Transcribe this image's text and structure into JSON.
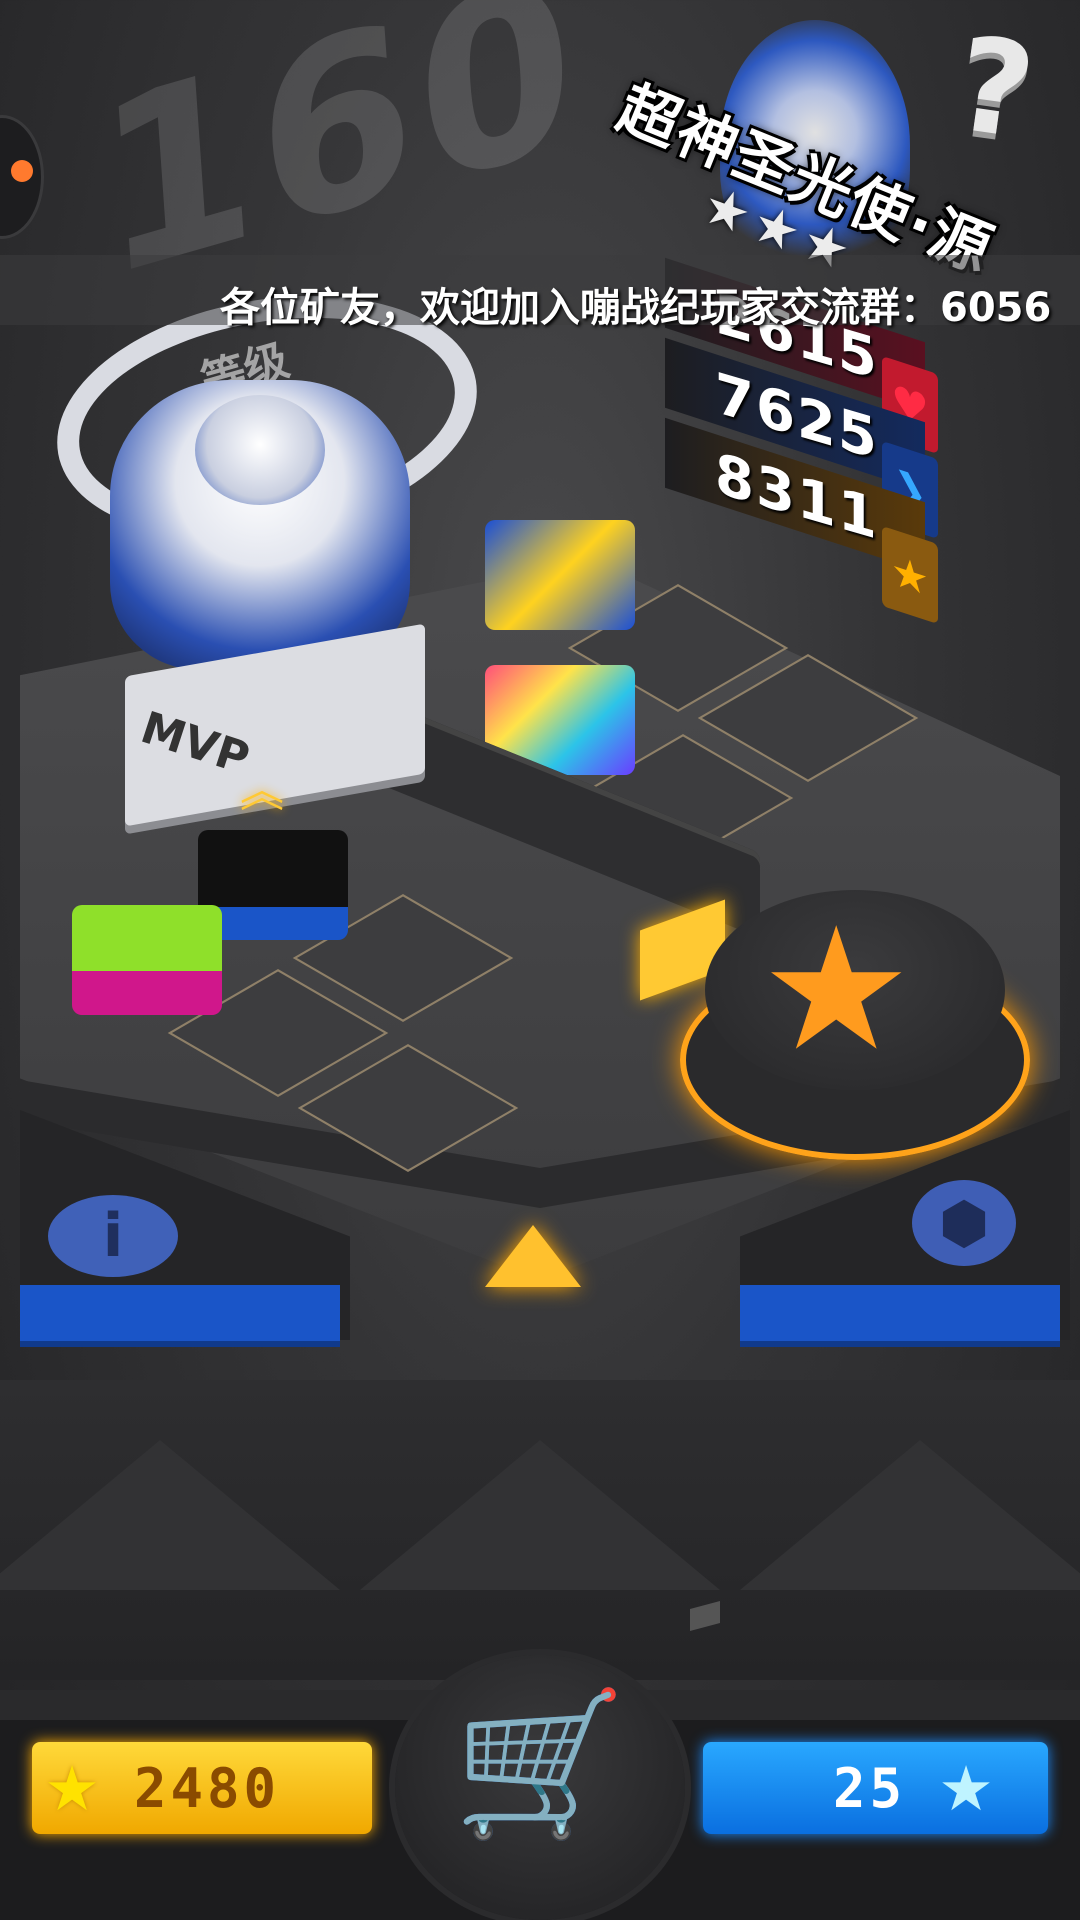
{
  "level": {
    "number": "160",
    "label": "等级"
  },
  "hero": {
    "name": "超神圣光使·源",
    "stars": "★★★"
  },
  "marquee": {
    "text": "各位矿友，欢迎加入嘣战纪玩家交流群：6056"
  },
  "stats": [
    {
      "value": "2615",
      "icon": "heart-icon",
      "color": "#e0243a"
    },
    {
      "value": "7625",
      "icon": "arrow-right-icon",
      "color": "#1f7cff"
    },
    {
      "value": "8311",
      "icon": "star-icon",
      "color": "#ffb000"
    }
  ],
  "pedestal": {
    "mvp": "MVP"
  },
  "currency": {
    "gold": "2480",
    "gems": "25"
  },
  "colors": {
    "gold": "#ffc933",
    "blue": "#1a55c8",
    "orange": "#ff9b1e"
  },
  "icons": {
    "help": "?",
    "star": "★",
    "info": "i",
    "cart": "🛒",
    "chevron": "︽",
    "ball": "⬢"
  }
}
